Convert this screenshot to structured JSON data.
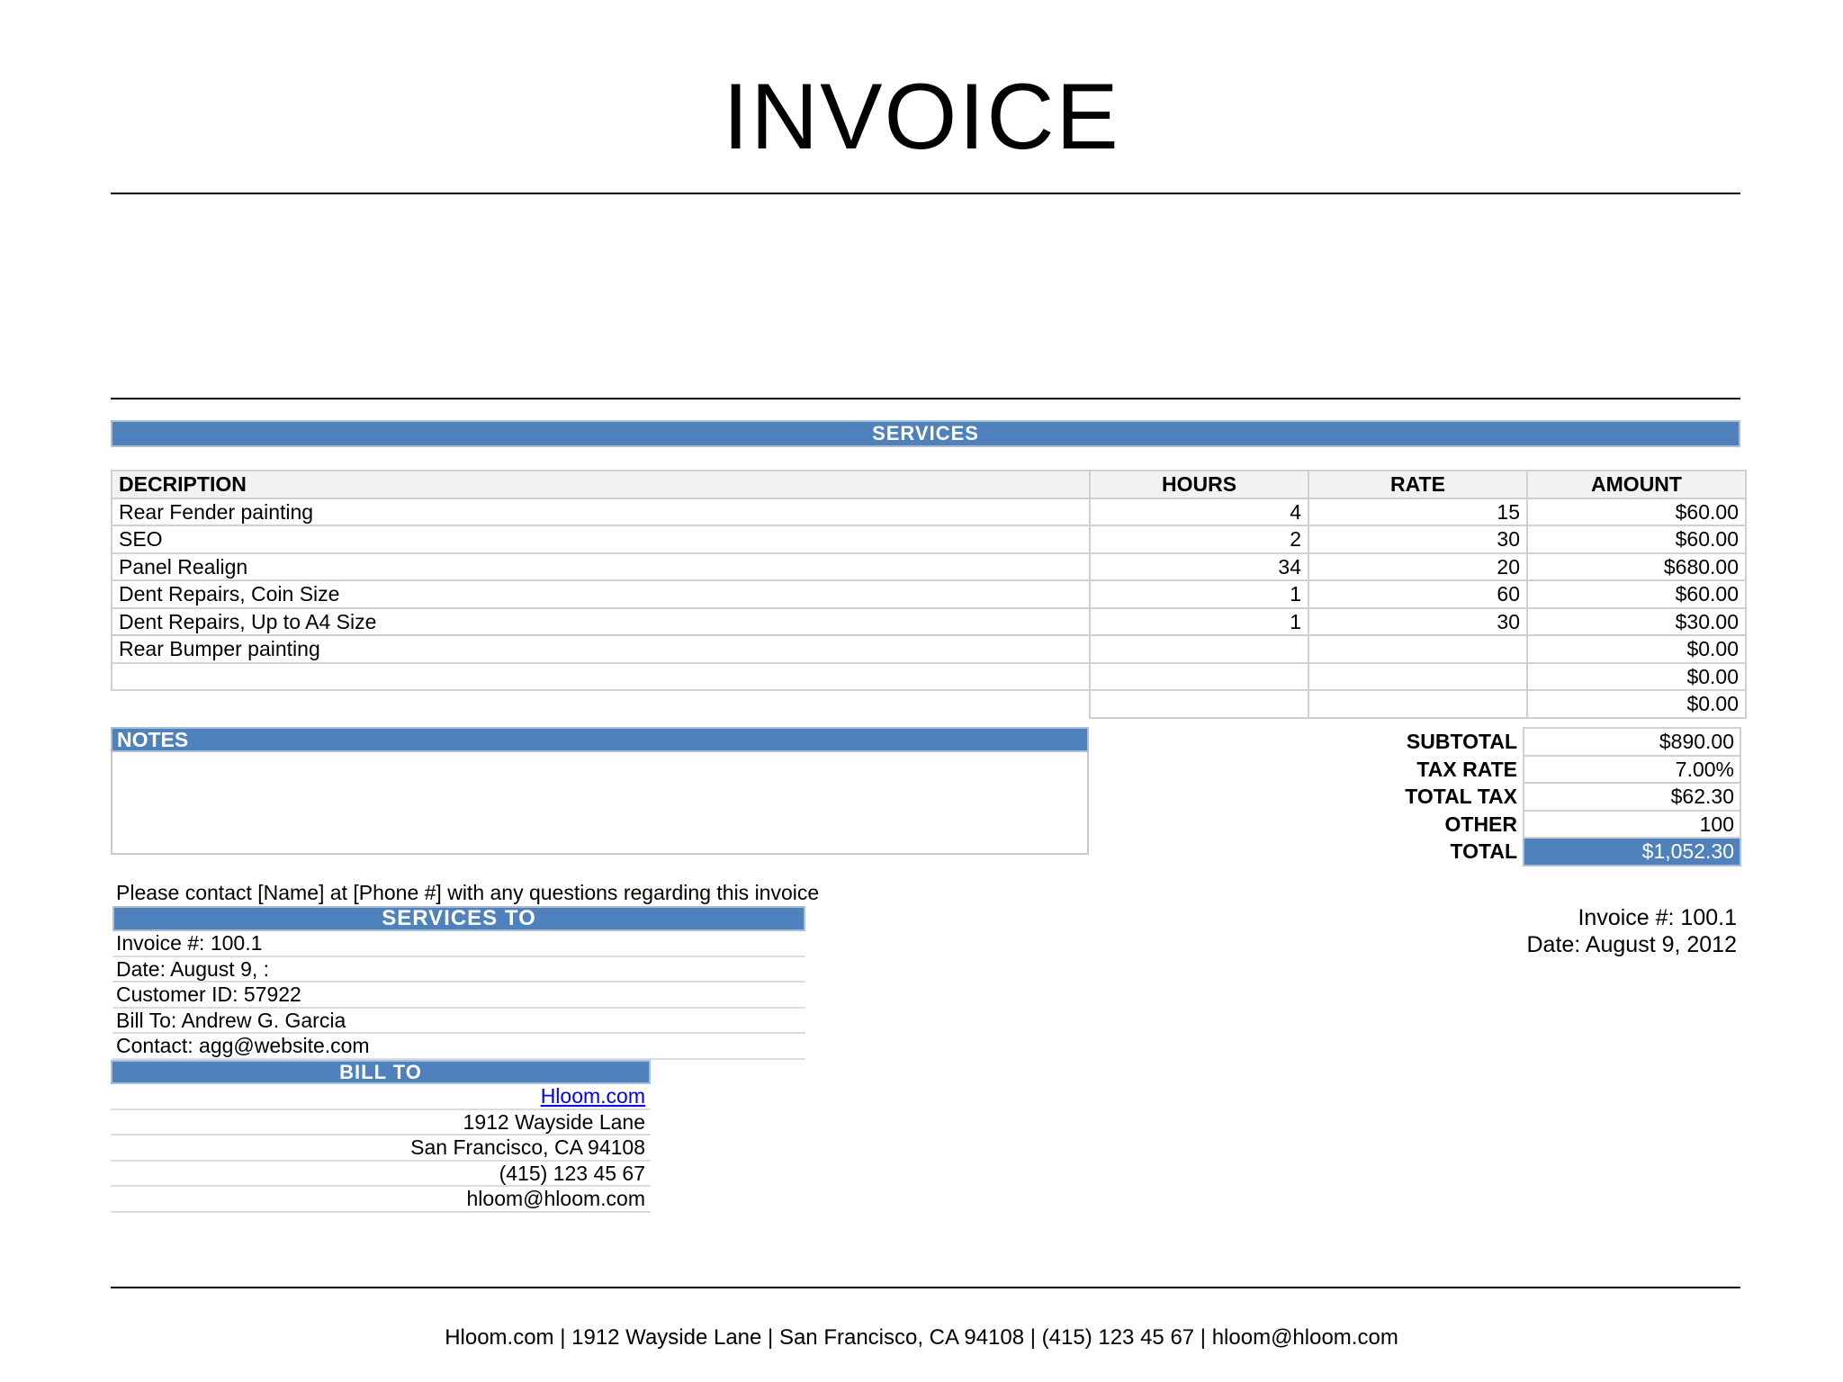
{
  "title": "INVOICE",
  "services_header": "SERVICES",
  "columns": [
    "DECRIPTION",
    "HOURS",
    "RATE",
    "AMOUNT"
  ],
  "line_items": [
    {
      "description": "Rear Fender painting",
      "hours": "4",
      "rate": "15",
      "amount": "$60.00"
    },
    {
      "description": "SEO",
      "hours": "2",
      "rate": "30",
      "amount": "$60.00"
    },
    {
      "description": "Panel Realign",
      "hours": "34",
      "rate": "20",
      "amount": "$680.00"
    },
    {
      "description": "Dent Repairs, Coin Size",
      "hours": "1",
      "rate": "60",
      "amount": "$60.00"
    },
    {
      "description": "Dent Repairs, Up to A4 Size",
      "hours": "1",
      "rate": "30",
      "amount": "$30.00"
    },
    {
      "description": "Rear Bumper painting",
      "hours": "",
      "rate": "",
      "amount": "$0.00"
    },
    {
      "description": "",
      "hours": "",
      "rate": "",
      "amount": "$0.00"
    },
    {
      "description": "",
      "hours": "",
      "rate": "",
      "amount": "$0.00"
    }
  ],
  "notes_header": "NOTES",
  "totals": {
    "subtotal_label": "SUBTOTAL",
    "subtotal": "$890.00",
    "tax_rate_label": "TAX RATE",
    "tax_rate": "7.00%",
    "total_tax_label": "TOTAL TAX",
    "total_tax": "$62.30",
    "other_label": "OTHER",
    "other": "100",
    "total_label": "TOTAL",
    "total": "$1,052.30"
  },
  "contact_line": "Please contact [Name] at [Phone #] with any questions regarding this invoice",
  "services_to": {
    "header": "SERVICES TO",
    "rows": [
      "Invoice #: 100.1",
      "Date: August 9, :",
      "Customer ID: 57922",
      "Bill To: Andrew G. Garcia",
      "Contact: agg@website.com"
    ]
  },
  "bill_to": {
    "header": "BILL TO",
    "website": "Hloom.com",
    "address": "1912 Wayside Lane",
    "city": "San Francisco, CA 94108",
    "phone": "(415) 123 45 67",
    "email": "hloom@hloom.com"
  },
  "invoice_info": {
    "number": "Invoice #: 100.1",
    "date": "Date: August 9, 2012"
  },
  "footer": "Hloom.com | 1912 Wayside Lane | San Francisco, CA 94108 | (415) 123 45 67 | hloom@hloom.com",
  "colors": {
    "accent": "#4f81bd",
    "header_fill": "#f2f2f2",
    "grid_line": "#d0d0d0"
  }
}
